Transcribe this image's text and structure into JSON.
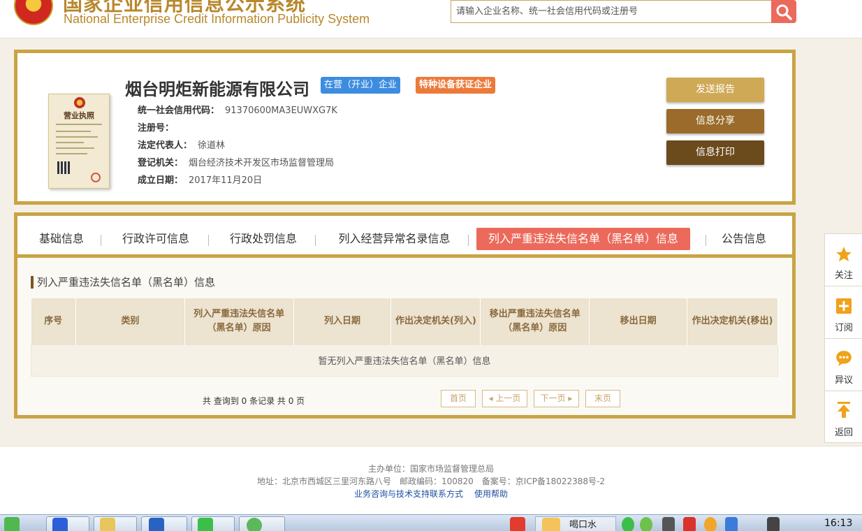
{
  "header": {
    "site_title_cn": "国家企业信用信息公示系统",
    "site_title_en": "National Enterprise Credit Information Publicity System",
    "search_placeholder": "请输入企业名称、统一社会信用代码或注册号"
  },
  "company": {
    "name": "烟台明炬新能源有限公司",
    "status_badge": "在营（开业）企业",
    "special_badge": "特种设备获证企业",
    "license_title": "营业执照",
    "fields": [
      {
        "label": "统一社会信用代码：",
        "value": "91370600MA3EUWXG7K"
      },
      {
        "label": "注册号：",
        "value": ""
      },
      {
        "label": "法定代表人：",
        "value": "徐道林"
      },
      {
        "label": "登记机关：",
        "value": "烟台经济技术开发区市场监督管理局"
      },
      {
        "label": "成立日期：",
        "value": "2017年11月20日"
      }
    ],
    "actions": [
      {
        "label": "发送报告",
        "color": "#d0a957"
      },
      {
        "label": "信息分享",
        "color": "#9a6b2a"
      },
      {
        "label": "信息打印",
        "color": "#6b4a1c"
      }
    ]
  },
  "tabs": [
    {
      "label": "基础信息",
      "active": false
    },
    {
      "label": "行政许可信息",
      "active": false
    },
    {
      "label": "行政处罚信息",
      "active": false
    },
    {
      "label": "列入经营异常名录信息",
      "active": false
    },
    {
      "label": "列入严重违法失信名单（黑名单）信息",
      "active": true
    },
    {
      "label": "公告信息",
      "active": false
    }
  ],
  "section": {
    "title": "列入严重违法失信名单（黑名单）信息",
    "columns": [
      "序号",
      "类别",
      "列入严重违法失信名单（黑名单）原因",
      "列入日期",
      "作出决定机关(列入)",
      "移出严重违法失信名单（黑名单）原因",
      "移出日期",
      "作出决定机关(移出)"
    ],
    "empty_text": "暂无列入严重违法失信名单（黑名单）信息",
    "pager": {
      "info": "共 查询到 0 条记录 共 0 页",
      "first": "首页",
      "prev": "上一页",
      "next": "下一页",
      "last": "末页"
    }
  },
  "sidebar": {
    "items": [
      {
        "label": "关注",
        "icon": "star-icon"
      },
      {
        "label": "订阅",
        "icon": "plus-icon"
      },
      {
        "label": "异议",
        "icon": "chat-icon"
      },
      {
        "label": "返回",
        "icon": "up-arrow-icon"
      }
    ]
  },
  "footer": {
    "host": "主办单位：国家市场监督管理总局",
    "address": "地址：北京市西城区三里河东路八号　邮政编码：100820　备案号：京ICP备18022388号-2",
    "link_support": "业务咨询与技术支持联系方式",
    "link_help": "使用帮助"
  },
  "taskbar": {
    "task_label": "喝口水",
    "time": "16:13"
  },
  "colors": {
    "gold_border": "#c9a443",
    "active_tab": "#ec6a5c",
    "status_blue": "#3d8ce0",
    "special_orange": "#ec7a3b"
  }
}
